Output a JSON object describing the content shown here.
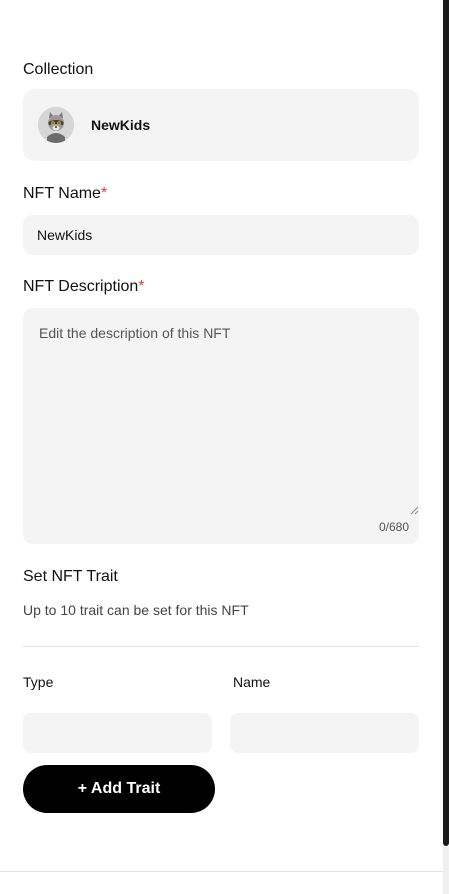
{
  "collection": {
    "label": "Collection",
    "name": "NewKids",
    "avatar_icon": "raccoon-avatar"
  },
  "nft_name": {
    "label": "NFT Name",
    "required_mark": "*",
    "value": "NewKids"
  },
  "nft_description": {
    "label": "NFT Description",
    "required_mark": "*",
    "value": "",
    "placeholder": "Edit the description of this NFT",
    "counter": "0/680"
  },
  "traits": {
    "title": "Set NFT Trait",
    "subtitle": "Up to 10 trait can be set for this NFT",
    "type_label": "Type",
    "name_label": "Name",
    "type_value": "",
    "name_value": "",
    "add_button_label": "+ Add Trait"
  },
  "colors": {
    "required": "#e03a3a",
    "field_bg": "#f4f4f4",
    "button_bg": "#000000"
  }
}
